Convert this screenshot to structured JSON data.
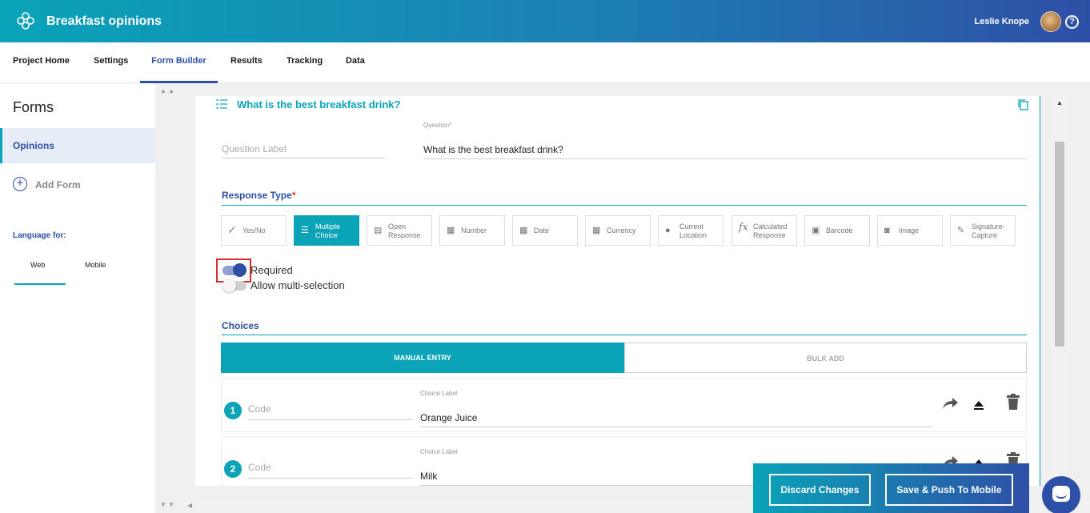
{
  "app": {
    "title": "Breakfast opinions",
    "user_name": "Leslie Knope",
    "help_glyph": "?"
  },
  "nav": {
    "tabs": [
      {
        "label": "Project Home"
      },
      {
        "label": "Settings"
      },
      {
        "label": "Form Builder",
        "active": true
      },
      {
        "label": "Results"
      },
      {
        "label": "Tracking"
      },
      {
        "label": "Data"
      }
    ]
  },
  "sidebar": {
    "title": "Forms",
    "forms": [
      {
        "label": "Opinions",
        "selected": true
      }
    ],
    "add_form_label": "Add Form",
    "language_label": "Language for:",
    "language_tabs": [
      {
        "label": "Web",
        "active": true
      },
      {
        "label": "Mobile"
      }
    ]
  },
  "question": {
    "header_title": "What is the best breakfast drink?",
    "label_placeholder": "Question Label",
    "question_caption": "Question*",
    "question_value": "What is the best breakfast drink?",
    "response_type_title": "Response Type",
    "required_star": "*",
    "response_types": [
      {
        "label": "Yes/No",
        "icon": "yes-no-icon"
      },
      {
        "label": "Multiple Choice",
        "icon": "list-icon",
        "active": true
      },
      {
        "label": "Open Response",
        "icon": "text-box-icon"
      },
      {
        "label": "Number",
        "icon": "calculator-icon"
      },
      {
        "label": "Date",
        "icon": "calendar-icon"
      },
      {
        "label": "Currency",
        "icon": "calculator-icon"
      },
      {
        "label": "Current Location",
        "icon": "location-pin-icon"
      },
      {
        "label": "Calculated Response",
        "icon": "fx-icon"
      },
      {
        "label": "Barcode",
        "icon": "barcode-icon"
      },
      {
        "label": "Image",
        "icon": "camera-icon"
      },
      {
        "label": "Signature-Capture",
        "icon": "pen-icon"
      }
    ],
    "required_label": "Required",
    "required_on": true,
    "multi_label": "Allow multi-selection",
    "multi_on": false,
    "choices_title": "Choices",
    "entry_tabs": {
      "manual": "MANUAL ENTRY",
      "bulk": "BULK ADD"
    },
    "choices": [
      {
        "number": "1",
        "code_placeholder": "Code",
        "caption": "Choice Label",
        "label": "Orange Juice"
      },
      {
        "number": "2",
        "code_placeholder": "Code",
        "caption": "Choice Label",
        "label": "Milk"
      }
    ]
  },
  "actions": {
    "discard": "Discard Changes",
    "save": "Save & Push To Mobile"
  },
  "colors": {
    "teal": "#0aa3b8",
    "blue": "#2e4fa6",
    "highlight": "#d32f2f"
  }
}
